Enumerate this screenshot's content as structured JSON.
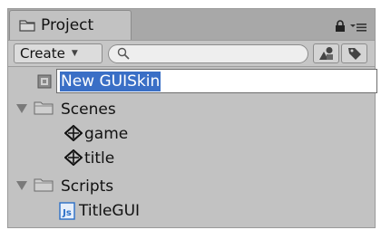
{
  "tab": {
    "label": "Project"
  },
  "toolbar": {
    "create_label": "Create",
    "search_placeholder": ""
  },
  "tree": {
    "rename_value": "New GUISkin",
    "items": [
      {
        "label": "Scenes"
      },
      {
        "label": "game"
      },
      {
        "label": "title"
      },
      {
        "label": "Scripts"
      },
      {
        "label": "TitleGUI"
      }
    ]
  },
  "colors": {
    "panel": "#c2c2c2",
    "selection": "#3a6fc6",
    "script_icon": "#2b6fc7"
  }
}
